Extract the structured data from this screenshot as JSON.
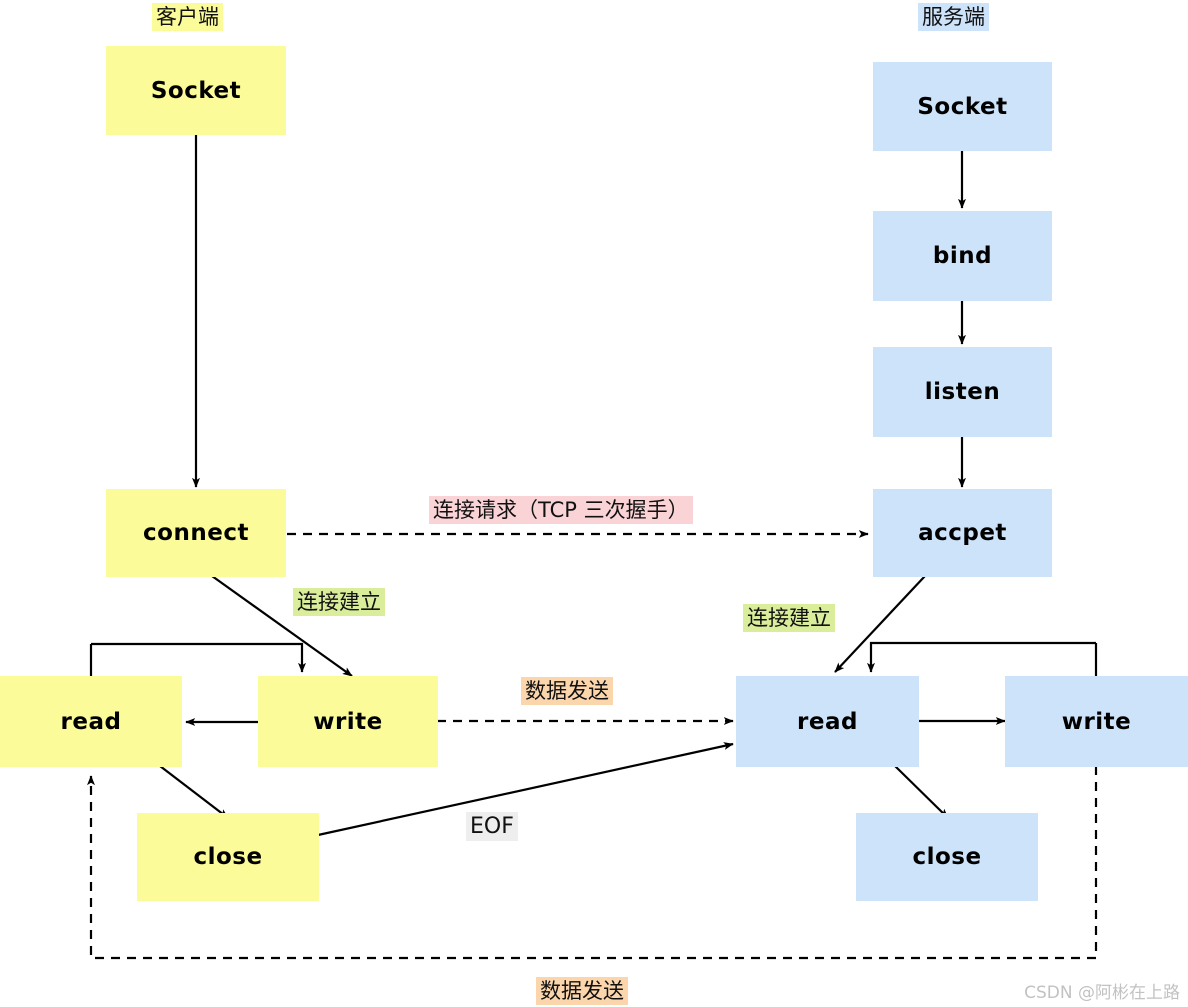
{
  "diagram": {
    "title_client": "客户端",
    "title_server": "服务端",
    "watermark": "CSDN @阿彬在上路",
    "colors": {
      "client_fill": "#fbfb99",
      "server_fill": "#cde3fa",
      "handshake_tag": "#fad3d6",
      "established_tag": "#d9ed9a",
      "datasend_tag": "#fbd6ad",
      "eof_tag": "#eeeeee",
      "stroke": "#000000"
    }
  },
  "client": {
    "label": "客户端",
    "nodes": [
      {
        "id": "c-socket",
        "label": "Socket"
      },
      {
        "id": "c-connect",
        "label": "connect"
      },
      {
        "id": "c-read",
        "label": "read"
      },
      {
        "id": "c-write",
        "label": "write"
      },
      {
        "id": "c-close",
        "label": "close"
      }
    ]
  },
  "server": {
    "label": "服务端",
    "nodes": [
      {
        "id": "s-socket",
        "label": "Socket"
      },
      {
        "id": "s-bind",
        "label": "bind"
      },
      {
        "id": "s-listen",
        "label": "listen"
      },
      {
        "id": "s-accept",
        "label": "accpet"
      },
      {
        "id": "s-read",
        "label": "read"
      },
      {
        "id": "s-write",
        "label": "write"
      },
      {
        "id": "s-close",
        "label": "close"
      }
    ]
  },
  "annotations": {
    "handshake": "连接请求（TCP 三次握手）",
    "established_client": "连接建立",
    "established_server": "连接建立",
    "data_send_top": "数据发送",
    "data_send_bottom": "数据发送",
    "eof": "EOF"
  }
}
